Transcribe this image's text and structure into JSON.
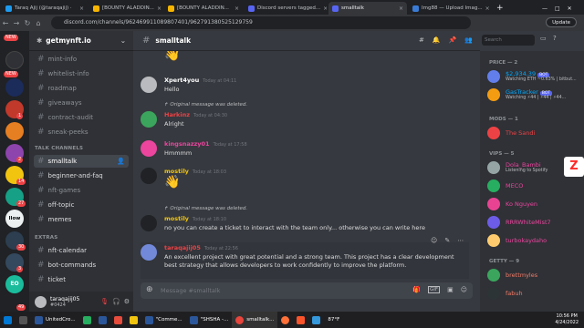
{
  "browser": {
    "tabs": [
      {
        "label": "Taraq Ajij (@taraqajij) ·",
        "color": "#1d9bf0",
        "active": false
      },
      {
        "label": "[BOUNTY ALADDIN...",
        "color": "#f7b500",
        "active": false
      },
      {
        "label": "[BOUNTY ALADDIN...",
        "color": "#f7b500",
        "active": false
      },
      {
        "label": "Discord servers tagged...",
        "color": "#5865f2",
        "active": false
      },
      {
        "label": "smalltalk",
        "color": "#5865f2",
        "active": true
      },
      {
        "label": "Img88 — Upload Imag...",
        "color": "#3a7bd5",
        "active": false
      }
    ],
    "url": "discord.com/channels/962469911089807401/962791380525129759",
    "update_label": "Update"
  },
  "servers": {
    "new_top": "NEW",
    "new_mid": "NEW",
    "badges": [
      "1",
      "2",
      "14",
      "27",
      "30",
      "3",
      "49"
    ],
    "labels": [
      "llow",
      "EO"
    ]
  },
  "channels": {
    "server_name": "getmynft.io",
    "items": [
      {
        "label": "mint-info",
        "prefix": "#"
      },
      {
        "label": "whitelist-info",
        "prefix": "#"
      },
      {
        "label": "roadmap",
        "prefix": "#"
      },
      {
        "label": "giveaways",
        "prefix": "#"
      },
      {
        "label": "contract-audit",
        "prefix": "#"
      },
      {
        "label": "sneak-peeks",
        "prefix": "#"
      }
    ],
    "cat_talk": "TALK CHANNELS",
    "talk": [
      {
        "label": "smalltalk",
        "selected": true
      },
      {
        "label": "beginner-and-faq",
        "selected": false
      },
      {
        "label": "nft-games",
        "selected": false
      },
      {
        "label": "off-topic",
        "selected": false
      },
      {
        "label": "memes",
        "selected": false
      }
    ],
    "cat_extras": "EXTRAS",
    "extras": [
      {
        "label": "nft-calendar"
      },
      {
        "label": "bot-commands"
      },
      {
        "label": "ticket"
      }
    ],
    "user": {
      "name": "taraqajij05",
      "tag": "#0424"
    }
  },
  "chat": {
    "channel": "smalltalk",
    "composer_placeholder": "Message #smalltalk",
    "messages": [
      {
        "author": "Xpert4you",
        "color": "#ffffff",
        "time": "Today at 04:11",
        "text": "Hello"
      },
      {
        "deleted": "Original message was deleted.",
        "author": "Harkinz",
        "color": "#ed4245",
        "time": "Today at 04:30",
        "text": "Alright"
      },
      {
        "author": "kingsnazzy01",
        "color": "#eb459e",
        "time": "Today at 17:58",
        "text": "Hmmmm"
      },
      {
        "author": "mostily",
        "color": "#f1c40f",
        "time": "Today at 18:03",
        "text": "👋"
      },
      {
        "deleted": "Original message was deleted.",
        "author": "mostily",
        "color": "#f1c40f",
        "time": "Today at 18:10",
        "text": "no you can create a ticket to interact with the team only... otherwise you can write here"
      },
      {
        "author": "taraqajij05",
        "color": "#ed4245",
        "time": "Today at 22:56",
        "text": "An excellent project with great potential and a strong team. This project has a clear development best strategy that allows developers to work confidently to improve the platform."
      }
    ]
  },
  "members": {
    "search_placeholder": "Search",
    "cat_price": "PRICE — 2",
    "price": [
      {
        "name": "$2,934.39",
        "status": "Watching ETH ~0.63% | bitbut...",
        "color": "#00a8fc",
        "bot": "BOT"
      },
      {
        "name": "GasTracker",
        "status": "Watching ⚡44 | ⚡44 | ⚡44...",
        "color": "#00a8fc",
        "bot": "BOT"
      }
    ],
    "cat_mods": "MODS — 1",
    "mods": [
      {
        "name": "The Sandi",
        "color": "#ed4245"
      }
    ],
    "cat_vips": "VIPS — 5",
    "vips": [
      {
        "name": "Dola_Bambi",
        "status": "Listening to Spotify",
        "color": "#eb459e"
      },
      {
        "name": "MECO",
        "status": "",
        "color": "#eb459e"
      },
      {
        "name": "Ko Nguyen",
        "status": "",
        "color": "#eb459e"
      },
      {
        "name": "RRRWhiteMist7",
        "status": "",
        "color": "#eb459e"
      },
      {
        "name": "turbokaydaho",
        "status": "",
        "color": "#eb459e"
      }
    ],
    "cat_getty": "GETTY — 9",
    "getty": [
      {
        "name": "brettmyles",
        "color": "#f47b67"
      },
      {
        "name": "fabuh",
        "color": "#f47b67"
      }
    ]
  },
  "taskbar": {
    "items": [
      "UnitedCro...",
      "\"Comme...",
      "\"SHSHA -...",
      "smalltalk..."
    ],
    "temp": "87°F",
    "time": "10:56 PM",
    "date": "4/24/2022"
  }
}
